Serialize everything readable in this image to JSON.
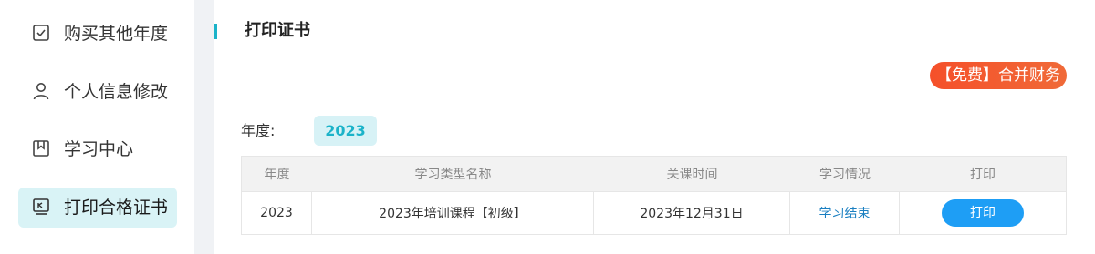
{
  "sidebar": {
    "items": [
      {
        "label": "购买其他年度",
        "icon": "checkbox-icon",
        "active": false
      },
      {
        "label": "个人信息修改",
        "icon": "user-icon",
        "active": false
      },
      {
        "label": "学习中心",
        "icon": "bookmark-icon",
        "active": false
      },
      {
        "label": "打印合格证书",
        "icon": "certificate-icon",
        "active": true
      }
    ]
  },
  "main": {
    "title": "打印证书",
    "promo_label": "【免费】合并财务",
    "year_label": "年度:",
    "year_value": "2023",
    "table": {
      "headers": [
        "年度",
        "学习类型名称",
        "关课时间",
        "学习情况",
        "打印"
      ],
      "rows": [
        {
          "year": "2023",
          "course": "2023年培训课程【初级】",
          "close_time": "2023年12月31日",
          "status": "学习结束",
          "action": "打印"
        }
      ]
    }
  },
  "colors": {
    "accent": "#1bb3c9",
    "active_bg": "#d9f3f6",
    "promo": "#f5502a",
    "print_button": "#1e9ef5",
    "link": "#1a7fc1"
  }
}
